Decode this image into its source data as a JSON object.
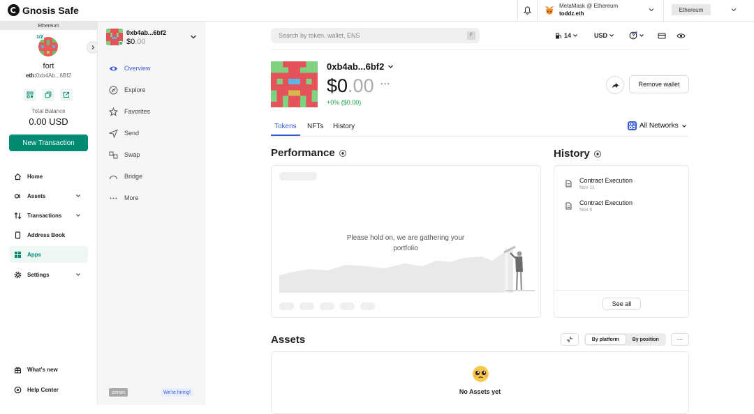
{
  "topbar": {
    "brand": "Gnosis Safe",
    "account_line1": "MetaMask @ Ethereum",
    "account_line2": "toddz.eth",
    "network": "Ethereum"
  },
  "sidebar": {
    "network": "Ethereum",
    "threshold": "1/2",
    "safe_name": "fort",
    "safe_address_prefix": "eth:",
    "safe_address": "0xb4Ab...6Bf2",
    "total_balance_label": "Total Balance",
    "total_balance": "0.00 USD",
    "new_transaction": "New Transaction",
    "nav": [
      {
        "label": "Home",
        "icon": "home-icon"
      },
      {
        "label": "Assets",
        "icon": "assets-icon"
      },
      {
        "label": "Transactions",
        "icon": "transactions-icon"
      },
      {
        "label": "Address Book",
        "icon": "address-book-icon"
      },
      {
        "label": "Apps",
        "icon": "apps-icon",
        "active": true
      },
      {
        "label": "Settings",
        "icon": "settings-icon"
      }
    ],
    "footer": [
      {
        "label": "What's new",
        "icon": "gift-icon"
      },
      {
        "label": "Help Center",
        "icon": "help-icon"
      }
    ]
  },
  "subnav": {
    "wallet_name": "0xb4ab...6bf2",
    "wallet_balance_int": "$0",
    "wallet_balance_dec": ".00",
    "items": [
      {
        "label": "Overview",
        "icon": "eye-icon",
        "active": true
      },
      {
        "label": "Explore",
        "icon": "compass-icon"
      },
      {
        "label": "Favorites",
        "icon": "star-icon"
      },
      {
        "label": "Send",
        "icon": "send-icon"
      },
      {
        "label": "Swap",
        "icon": "swap-icon"
      },
      {
        "label": "Bridge",
        "icon": "bridge-icon"
      },
      {
        "label": "More",
        "icon": "dots-icon"
      }
    ],
    "brand_badge": "zerion",
    "hiring": "We're hiring!"
  },
  "main": {
    "search_placeholder": "Search by token, wallet, ENS",
    "search_key": "F",
    "gas": "14",
    "currency": "USD",
    "wallet_name": "0xb4ab...6bf2",
    "balance_int": "$0",
    "balance_dec": ".00",
    "balance_more": "···",
    "change": "+0% ($0.00)",
    "remove_wallet": "Remove wallet",
    "tabs": [
      "Tokens",
      "NFTs",
      "History"
    ],
    "active_tab": "Tokens",
    "all_networks": "All Networks",
    "performance_title": "Performance",
    "performance_message": "Please hold on, we are gathering your portfolio",
    "history_title": "History",
    "history_items": [
      {
        "title": "Contract Execution",
        "date": "Nov 11"
      },
      {
        "title": "Contract Execution",
        "date": "Nov 6"
      }
    ],
    "see_all": "See all",
    "assets_title": "Assets",
    "assets_view_options": [
      "By platform",
      "By position"
    ],
    "assets_view_selected": "By platform",
    "assets_more": "···",
    "assets_empty": "No Assets yet"
  },
  "colors": {
    "brand_green": "#008c73",
    "accent_blue": "#3b5bdb",
    "positive_green": "#1aa344"
  }
}
